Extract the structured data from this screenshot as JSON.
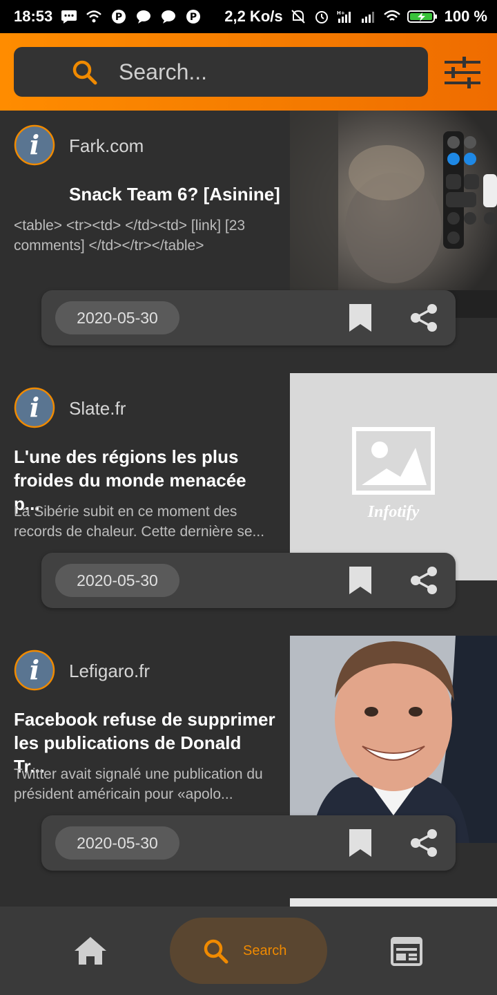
{
  "status_bar": {
    "time": "18:53",
    "net_speed": "2,2 Ko/s",
    "battery": "100 %",
    "signal_label": "H+"
  },
  "search": {
    "placeholder": "Search..."
  },
  "articles": [
    {
      "source": "Fark.com",
      "title": "Snack Team 6? [Asinine]",
      "summary": "<table> <tr><td> </td><td> [link] [23 comments] </td></tr></table>",
      "date": "2020-05-30",
      "thumbnail": "control-center-photo"
    },
    {
      "source": "Slate.fr",
      "title": "L'une des régions les plus froides du monde menacée p...",
      "summary": "La Sibérie subit en ce moment des records de chaleur. Cette dernière se...",
      "date": "2020-05-30",
      "thumbnail": "placeholder",
      "placeholder_label": "Infotify"
    },
    {
      "source": "Lefigaro.fr",
      "title": "Facebook refuse de supprimer les publications de Donald Tr...",
      "summary": "Twitter avait signalé une publication du président américain pour «apolo...",
      "date": "2020-05-30",
      "thumbnail": "portrait-photo"
    }
  ],
  "bottom_nav": {
    "home_icon": "home-icon",
    "search_label": "Search",
    "news_icon": "newspaper-icon"
  },
  "colors": {
    "accent": "#f08a00",
    "header_gradient_start": "#ff8c00",
    "header_gradient_end": "#ef6c00",
    "background": "#2f2f2f",
    "card_action_bar": "#414141"
  }
}
